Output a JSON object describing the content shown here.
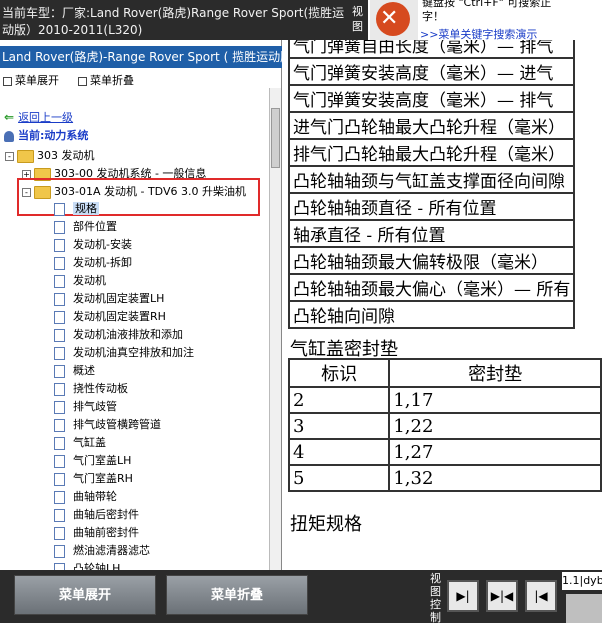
{
  "header": {
    "vehicle_line1": "当前车型：厂家:Land Rover(路虎)Range Rover Sport(揽胜运",
    "vehicle_line2": "动版）2010-2011(L320)",
    "view_label": "视图",
    "search_hint": "键盘按 \"Ctrl+F\" 可搜索正\n字！",
    "search_link": ">>菜单关键字搜索演示"
  },
  "left_panel": {
    "title": "Land Rover(路虎)-Range Rover Sport ( 揽胜运动版",
    "toolbar": {
      "expand": "菜单展开",
      "collapse": "菜单折叠"
    },
    "back_link": "返回上一级",
    "current_label": "当前:动力系统",
    "tree": {
      "root": {
        "label": "303 发动机",
        "toggle": "-"
      },
      "node_00": {
        "label": "303-00 发动机系统 - 一般信息",
        "toggle": "+"
      },
      "node_01A": {
        "label": "303-01A 发动机 - TDV6 3.0 升柴油机",
        "toggle": "-"
      },
      "leaves": [
        "规格",
        "部件位置",
        "发动机-安装",
        "发动机-拆卸",
        "发动机",
        "发动机固定装置LH",
        "发动机固定装置RH",
        "发动机油液排放和添加",
        "发动机油真空排放和加注",
        "概述",
        "挠性传动板",
        "排气歧管",
        "排气歧管横跨管道",
        "气缸盖",
        "气门室盖LH",
        "气门室盖RH",
        "曲轴带轮",
        "曲轴后密封件",
        "曲轴前密封件",
        "燃油滤清器滤芯",
        "凸轮轴LH"
      ],
      "selected_index": 0
    }
  },
  "content": {
    "spec_rows": [
      "气门弹簧自由长度（毫米）— 排气",
      "气门弹簧安装高度（毫米）— 进气",
      "气门弹簧安装高度（毫米）— 排气",
      "进气门凸轮轴最大凸轮升程（毫米）",
      "排气门凸轮轴最大凸轮升程（毫米）",
      "凸轮轴轴颈与气缸盖支撑面径向间隙",
      "凸轮轴轴颈直径 - 所有位置",
      "轴承直径 - 所有位置",
      "凸轮轴轴颈最大偏转极限（毫米）",
      "凸轮轴轴颈最大偏心（毫米）— 所有",
      "凸轮轴向间隙"
    ],
    "gasket_title": "气缸盖密封垫",
    "gasket_headers": [
      "标识",
      "密封垫"
    ],
    "gasket_rows": [
      [
        "2",
        "1,17"
      ],
      [
        "3",
        "1,22"
      ],
      [
        "4",
        "1,27"
      ],
      [
        "5",
        "1,32"
      ]
    ],
    "torque_title": "扭矩规格"
  },
  "footer": {
    "expand_button": "菜单展开",
    "collapse_button": "菜单折叠",
    "view_control": "视图控制",
    "nav_left": "▶|",
    "nav_center": "▶|◀",
    "nav_right": "|◀",
    "version": "1.1|dyb"
  }
}
